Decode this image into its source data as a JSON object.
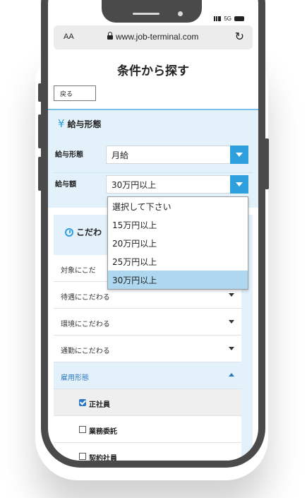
{
  "browser": {
    "aa_label": "AA",
    "url": "www.job-terminal.com",
    "network": "5G"
  },
  "page": {
    "title": "条件から探す",
    "back_label": "戻る"
  },
  "salary": {
    "heading_icon": "¥",
    "heading": "給与形態",
    "type_label": "給与形態",
    "type_value": "月給",
    "amount_label": "給与額",
    "amount_value": "30万円以上",
    "dropdown_options": [
      "選択して下さい",
      "15万円以上",
      "20万円以上",
      "25万円以上",
      "30万円以上"
    ],
    "selected_index": 4
  },
  "conditions": {
    "heading": "こだわ",
    "rows": [
      {
        "label": "対象にこだ"
      },
      {
        "label": "待遇にこだわる"
      },
      {
        "label": "環境にこだわる"
      },
      {
        "label": "通勤にこだわる"
      },
      {
        "label": "雇用形態"
      }
    ],
    "employment_options": [
      {
        "label": "正社員",
        "checked": true
      },
      {
        "label": "業務委託",
        "checked": false
      },
      {
        "label": "契約社員",
        "checked": false
      }
    ]
  },
  "colors": {
    "accent": "#2d9fdc",
    "panel_bg": "#e3f1fb",
    "selected_option_bg": "#add8f0",
    "phone_frame": "#4a4a4a"
  }
}
